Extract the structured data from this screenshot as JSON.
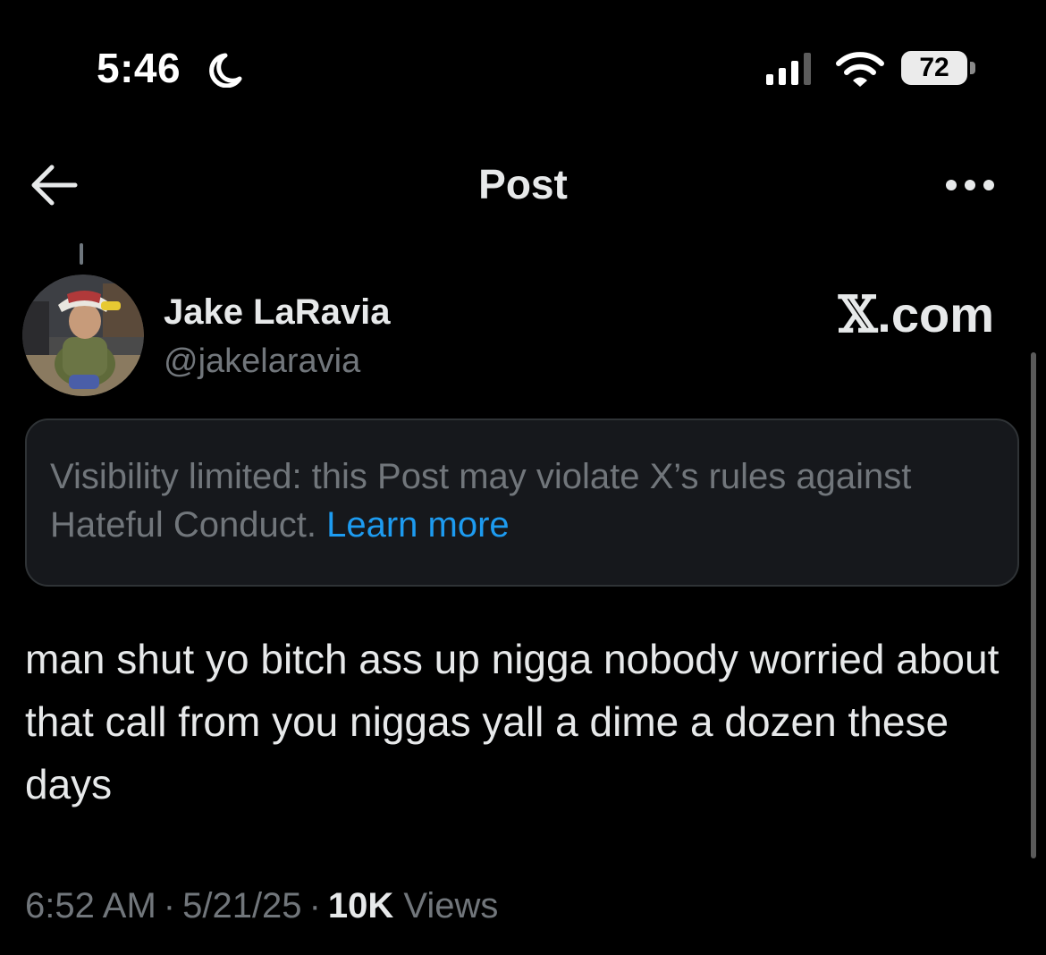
{
  "status_bar": {
    "time": "5:46",
    "battery": "72"
  },
  "header": {
    "title": "Post"
  },
  "author": {
    "name": "Jake LaRavia",
    "handle": "@jakelaravia"
  },
  "source": {
    "x_glyph": "𝕏",
    "suffix": ".com"
  },
  "notice": {
    "text": "Visibility limited: this Post may violate X’s rules against Hateful Conduct.",
    "link": "Learn more"
  },
  "tweet": {
    "text": "man shut yo bitch ass up nigga nobody worried about that call from you niggas yall a dime a dozen these days"
  },
  "meta": {
    "time": "6:52 AM",
    "date": "5/21/25",
    "views_count": "10K",
    "views_label": "Views",
    "separator": "·"
  },
  "colors": {
    "background": "#000000",
    "text": "#e7e9ea",
    "secondary": "#71767b",
    "link": "#1d9bf0",
    "notice_bg": "#16181c"
  },
  "icons": [
    "moon-icon",
    "signal-icon",
    "wifi-icon",
    "battery-icon",
    "back-arrow-icon",
    "more-icon"
  ]
}
